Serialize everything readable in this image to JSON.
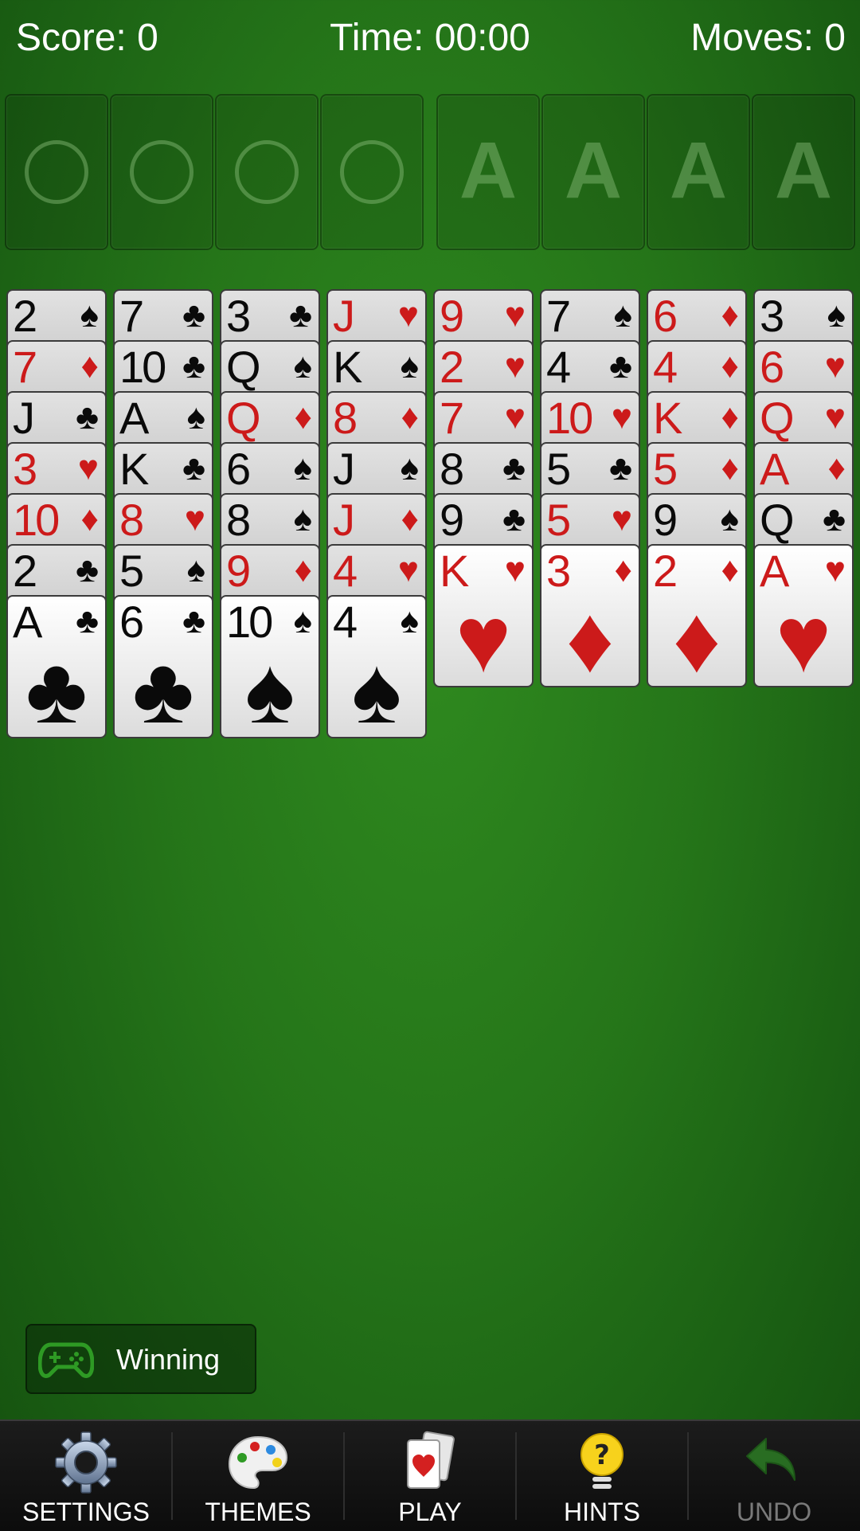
{
  "hud": {
    "score": "Score: 0",
    "time": "Time: 00:00",
    "moves": "Moves: 0"
  },
  "free_cells": 4,
  "foundations": [
    "A",
    "A",
    "A",
    "A"
  ],
  "columns": [
    [
      {
        "rank": "2",
        "suit": "♠"
      },
      {
        "rank": "7",
        "suit": "♦"
      },
      {
        "rank": "J",
        "suit": "♣"
      },
      {
        "rank": "3",
        "suit": "♥"
      },
      {
        "rank": "10",
        "suit": "♦"
      },
      {
        "rank": "2",
        "suit": "♣"
      },
      {
        "rank": "A",
        "suit": "♣"
      }
    ],
    [
      {
        "rank": "7",
        "suit": "♣"
      },
      {
        "rank": "10",
        "suit": "♣"
      },
      {
        "rank": "A",
        "suit": "♠"
      },
      {
        "rank": "K",
        "suit": "♣"
      },
      {
        "rank": "8",
        "suit": "♥"
      },
      {
        "rank": "5",
        "suit": "♠"
      },
      {
        "rank": "6",
        "suit": "♣"
      }
    ],
    [
      {
        "rank": "3",
        "suit": "♣"
      },
      {
        "rank": "Q",
        "suit": "♠"
      },
      {
        "rank": "Q",
        "suit": "♦"
      },
      {
        "rank": "6",
        "suit": "♠"
      },
      {
        "rank": "8",
        "suit": "♠"
      },
      {
        "rank": "9",
        "suit": "♦"
      },
      {
        "rank": "10",
        "suit": "♠"
      }
    ],
    [
      {
        "rank": "J",
        "suit": "♥"
      },
      {
        "rank": "K",
        "suit": "♠"
      },
      {
        "rank": "8",
        "suit": "♦"
      },
      {
        "rank": "J",
        "suit": "♠"
      },
      {
        "rank": "J",
        "suit": "♦"
      },
      {
        "rank": "4",
        "suit": "♥"
      },
      {
        "rank": "4",
        "suit": "♠"
      }
    ],
    [
      {
        "rank": "9",
        "suit": "♥"
      },
      {
        "rank": "2",
        "suit": "♥"
      },
      {
        "rank": "7",
        "suit": "♥"
      },
      {
        "rank": "8",
        "suit": "♣"
      },
      {
        "rank": "9",
        "suit": "♣"
      },
      {
        "rank": "K",
        "suit": "♥"
      }
    ],
    [
      {
        "rank": "7",
        "suit": "♠"
      },
      {
        "rank": "4",
        "suit": "♣"
      },
      {
        "rank": "10",
        "suit": "♥"
      },
      {
        "rank": "5",
        "suit": "♣"
      },
      {
        "rank": "5",
        "suit": "♥"
      },
      {
        "rank": "3",
        "suit": "♦"
      }
    ],
    [
      {
        "rank": "6",
        "suit": "♦"
      },
      {
        "rank": "4",
        "suit": "♦"
      },
      {
        "rank": "K",
        "suit": "♦"
      },
      {
        "rank": "5",
        "suit": "♦"
      },
      {
        "rank": "9",
        "suit": "♠"
      },
      {
        "rank": "2",
        "suit": "♦"
      }
    ],
    [
      {
        "rank": "3",
        "suit": "♠"
      },
      {
        "rank": "6",
        "suit": "♥"
      },
      {
        "rank": "Q",
        "suit": "♥"
      },
      {
        "rank": "A",
        "suit": "♦"
      },
      {
        "rank": "Q",
        "suit": "♣"
      },
      {
        "rank": "A",
        "suit": "♥"
      }
    ]
  ],
  "colors": {
    "red_suit": "#cc1a1a",
    "black_suit": "#0a0a0a",
    "felt": "#257519"
  },
  "winning_badge": {
    "label": "Winning",
    "icon": "gamepad-icon"
  },
  "bottom_bar": [
    {
      "label": "SETTINGS",
      "icon": "gear-icon",
      "enabled": true
    },
    {
      "label": "THEMES",
      "icon": "palette-icon",
      "enabled": true
    },
    {
      "label": "PLAY",
      "icon": "cards-icon",
      "enabled": true
    },
    {
      "label": "HINTS",
      "icon": "lightbulb-icon",
      "enabled": true
    },
    {
      "label": "UNDO",
      "icon": "undo-icon",
      "enabled": false
    }
  ]
}
